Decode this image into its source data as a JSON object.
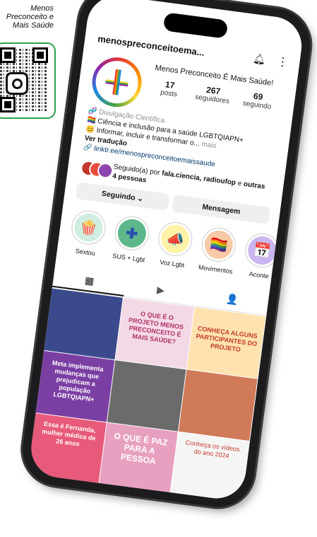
{
  "caption": {
    "line1": "Menos",
    "line2": "Preconceito e",
    "line3": "Mais Saúde"
  },
  "profile": {
    "username": "menospreconceitoema...",
    "full_name": "Menos Preconceito É Mais Saúde!",
    "stats": [
      {
        "value": "17",
        "label": "posts"
      },
      {
        "value": "267",
        "label": "seguidores"
      },
      {
        "value": "69",
        "label": "seguindo"
      }
    ],
    "bio": {
      "category": "🧬 Divulgação Científica",
      "line1": "🏳️‍🌈 Ciência e inclusão para a saúde LGBTQIAPN+",
      "line2": "😊 Informar, incluir e transformar o...",
      "more": "mais",
      "translate": "Ver tradução",
      "link": "🔗 linktr.ee/menospreconceitoemaissaude"
    },
    "followed_by_prefix": "Seguido(a) por",
    "followed_by_names": "fala.ciencia, radioufop",
    "followed_by_suffix": "e",
    "followed_by_others": "outras 4 pessoas"
  },
  "buttons": {
    "following": "Seguindo ⌄",
    "message": "Mensagem"
  },
  "highlights": [
    {
      "label": "Sextou",
      "icon": "🍿",
      "color": "#cfeee0"
    },
    {
      "label": "SUS + Lgbt",
      "icon": "✚",
      "color": "#5cb88a"
    },
    {
      "label": "Voz Lgbt",
      "icon": "📣",
      "color": "#fff3a8"
    },
    {
      "label": "Movimentos",
      "icon": "🏳️‍🌈",
      "color": "#f7c9a4"
    },
    {
      "label": "Aconte",
      "icon": "📅",
      "color": "#c9b6f0"
    }
  ],
  "tabs": {
    "grid": "▦",
    "reels": "▶",
    "tagged": "👤"
  },
  "posts": [
    {
      "text": "",
      "bg": "#3b4a8c"
    },
    {
      "text": "O QUE É O PROJETO MENOS PRECONCEITO É MAIS SAÚDE?",
      "bg": "#f3d9e6"
    },
    {
      "text": "CONHEÇA ALGUNS PARTICIPANTES DO PROJETO",
      "bg": "#ffe2b0"
    },
    {
      "text": "",
      "bg": "#8a6a55"
    },
    {
      "text": "Meta implementa mudanças que prejudicam a população LGBTQIAPN+",
      "bg": "#7b3fa3"
    },
    {
      "text": "",
      "bg": "#6b6b6b"
    },
    {
      "text": "",
      "bg": "#d07a5a"
    },
    {
      "text": "Essa é Fernanda, mulher médica de 26 anos",
      "bg": "#e85a7a"
    },
    {
      "text": "O QUE É PAZ PARA A PESSOA",
      "bg": "#e8a0c0"
    },
    {
      "text": "Conheça os vídeos do ano 2024",
      "bg": "#f5f5f5"
    }
  ],
  "colors": {
    "accent": "#0095f6",
    "frame": "#1c1c1e",
    "card_border": "#2aa24a"
  }
}
